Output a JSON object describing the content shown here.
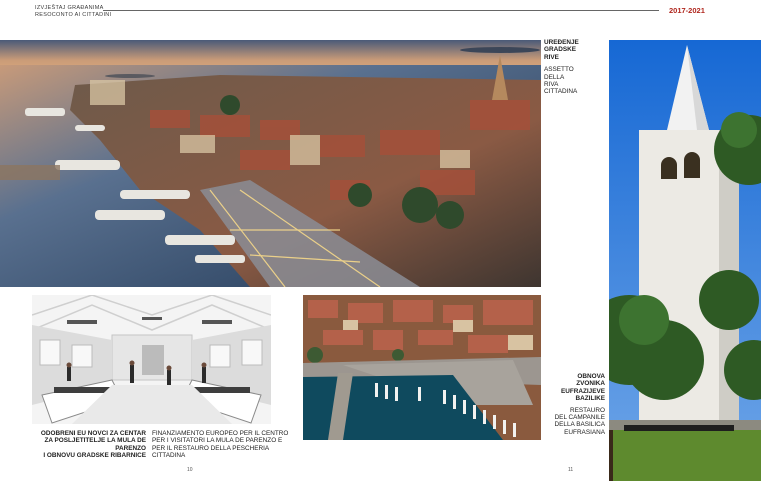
{
  "header": {
    "line1": "IZVJEŠTAJ GRAĐANIMA",
    "line2": "RESOCONTO AI CITTADINI",
    "years": "2017-2021"
  },
  "top_right_caption": {
    "hr1": "UREĐENJE",
    "hr2": "GRADSKE",
    "hr3": "RIVE",
    "it1": "ASSETTO",
    "it2": "DELLA",
    "it3": "RIVA",
    "it4": "CITTADINA"
  },
  "left_caption": {
    "hr1": "ODOBRENI EU NOVCI ZA CENTAR",
    "hr2": "ZA POSLJETITELJE LA MULA DE PARENZO",
    "hr3": "I OBNOVU GRADSKE RIBARNICE",
    "it1": "FINANZIAMENTO EUROPEO PER IL CENTRO",
    "it2": "PER I VISITATORI LA MULA DE PARENZO E",
    "it3": "PER IL RESTAURO DELLA PESCHERIA",
    "it4": "CITTADINA"
  },
  "right_caption": {
    "hr1": "OBNOVA",
    "hr2": "ZVONIKA",
    "hr3": "EUFRAZIJEVE",
    "hr4": "BAZILIKE",
    "it1": "RESTAURO",
    "it2": "DEL CAMPANILE",
    "it3": "DELLA BASILICA",
    "it4": "EUFRASIANA"
  },
  "page_numbers": {
    "left": "10",
    "right": "11"
  }
}
